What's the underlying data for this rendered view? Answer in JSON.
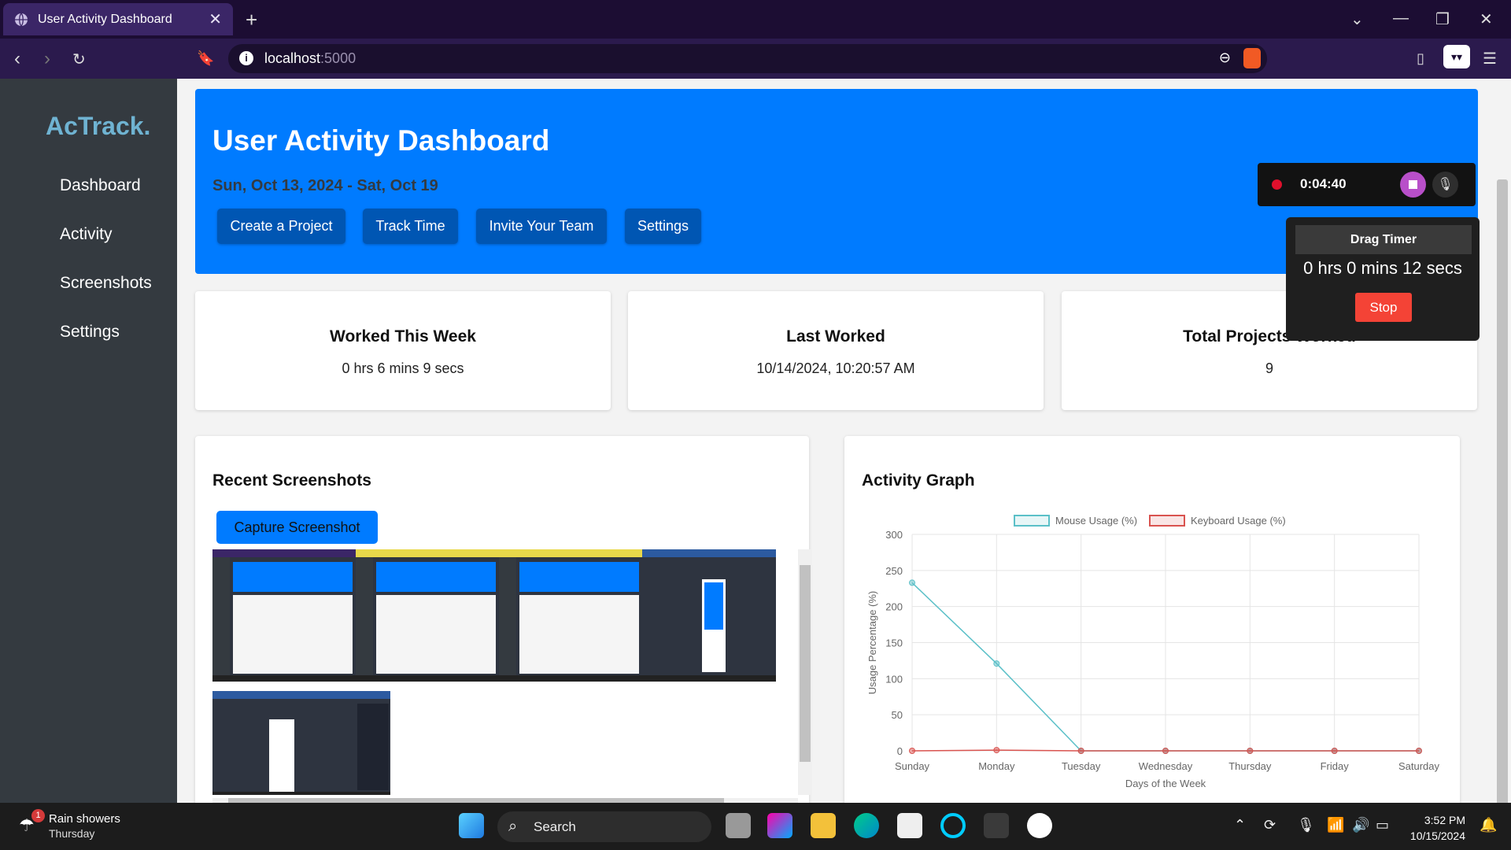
{
  "browser": {
    "tab_title": "User Activity Dashboard",
    "new_tab": "+",
    "url_host": "localhost",
    "url_port": ":5000"
  },
  "sidebar": {
    "logo": "AcTrack.",
    "items": [
      {
        "label": "Dashboard"
      },
      {
        "label": "Activity"
      },
      {
        "label": "Screenshots"
      },
      {
        "label": "Settings"
      }
    ]
  },
  "hero": {
    "title": "User Activity Dashboard",
    "date_range": "Sun, Oct 13, 2024 - Sat, Oct 19",
    "buttons": [
      {
        "label": "Create a Project"
      },
      {
        "label": "Track Time"
      },
      {
        "label": "Invite Your Team"
      },
      {
        "label": "Settings"
      }
    ]
  },
  "cards": [
    {
      "title": "Worked This Week",
      "value": "0 hrs 6 mins 9 secs"
    },
    {
      "title": "Last Worked",
      "value": "10/14/2024, 10:20:57 AM"
    },
    {
      "title": "Total Projects Worked",
      "value": "9"
    }
  ],
  "screenshots": {
    "title": "Recent Screenshots",
    "capture_label": "Capture Screenshot"
  },
  "activity": {
    "title": "Activity Graph"
  },
  "recorder": {
    "elapsed": "0:04:40",
    "drag_title": "Drag Timer",
    "drag_value": "0 hrs 0 mins 12 secs",
    "stop_label": "Stop"
  },
  "taskbar": {
    "weather_title": "Rain showers",
    "weather_day": "Thursday",
    "weather_badge": "1",
    "search_label": "Search",
    "time": "3:52 PM",
    "date": "10/15/2024"
  },
  "colors": {
    "accent": "#007bff",
    "sidebar": "#343a40",
    "mouse_series": "#5bc0c8",
    "keyboard_series": "#d9534f"
  },
  "chart_data": {
    "type": "line",
    "title": "",
    "xlabel": "Days of the Week",
    "ylabel": "Usage Percentage (%)",
    "categories": [
      "Sunday",
      "Monday",
      "Tuesday",
      "Wednesday",
      "Thursday",
      "Friday",
      "Saturday"
    ],
    "ylim": [
      0,
      300
    ],
    "yticks": [
      0,
      50,
      100,
      150,
      200,
      250,
      300
    ],
    "legend_position": "top",
    "grid": true,
    "series": [
      {
        "name": "Mouse Usage (%)",
        "color": "#5bc0c8",
        "values": [
          233,
          121,
          0,
          0,
          0,
          0,
          0
        ]
      },
      {
        "name": "Keyboard Usage (%)",
        "color": "#d9534f",
        "values": [
          0,
          1,
          0,
          0,
          0,
          0,
          0
        ]
      }
    ]
  }
}
